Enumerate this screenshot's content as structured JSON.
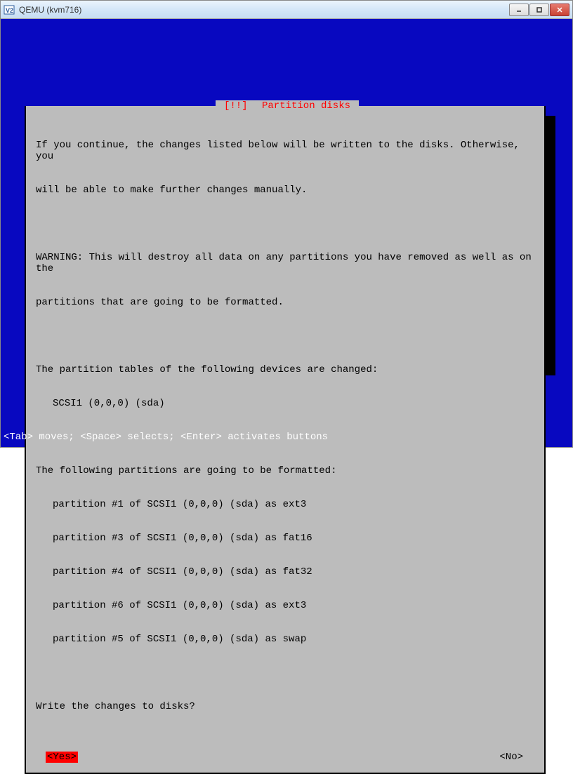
{
  "window": {
    "title": "QEMU (kvm716)",
    "icon": "vnc-icon"
  },
  "dialog": {
    "title_prefix": "[!!]",
    "title": "Partition disks",
    "intro_line1": "If you continue, the changes listed below will be written to the disks. Otherwise, you",
    "intro_line2": "will be able to make further changes manually.",
    "warning_line1": "WARNING: This will destroy all data on any partitions you have removed as well as on the",
    "warning_line2": "partitions that are going to be formatted.",
    "tables_header": "The partition tables of the following devices are changed:",
    "tables_items": [
      "SCSI1 (0,0,0) (sda)"
    ],
    "format_header": "The following partitions are going to be formatted:",
    "format_items": [
      "partition #1 of SCSI1 (0,0,0) (sda) as ext3",
      "partition #3 of SCSI1 (0,0,0) (sda) as fat16",
      "partition #4 of SCSI1 (0,0,0) (sda) as fat32",
      "partition #6 of SCSI1 (0,0,0) (sda) as ext3",
      "partition #5 of SCSI1 (0,0,0) (sda) as swap"
    ],
    "question": "Write the changes to disks?",
    "yes_label": "<Yes>",
    "no_label": "<No>"
  },
  "hint": "<Tab> moves; <Space> selects; <Enter> activates buttons"
}
